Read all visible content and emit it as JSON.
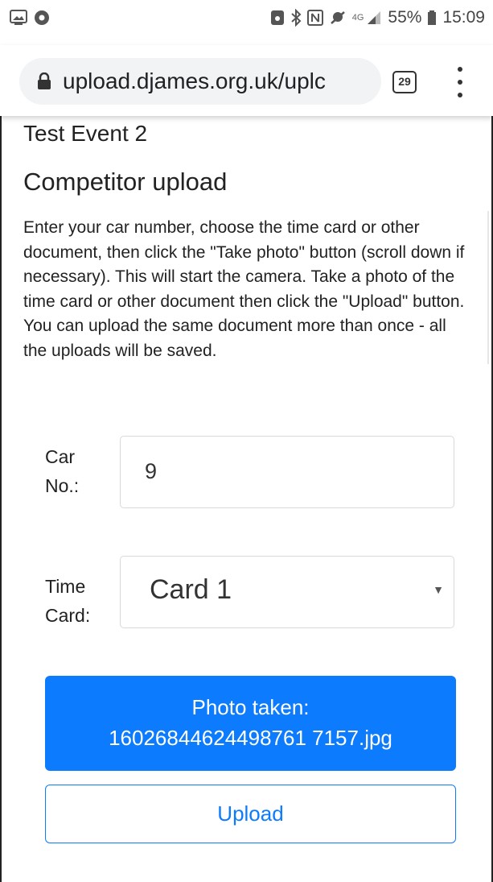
{
  "status_bar": {
    "network": "4G",
    "battery": "55%",
    "time": "15:09"
  },
  "browser": {
    "url": "upload.djames.org.uk/uplc",
    "tab_count": "29"
  },
  "page": {
    "event_name": "Test Event 2",
    "heading": "Competitor upload",
    "instructions": "Enter your car number, choose the time card or other document, then click the \"Take photo\" button (scroll down if necessary). This will start the camera. Take a photo of the time card or other document then click the \"Upload\" button. You can upload the same document more than once - all the uploads will be saved."
  },
  "form": {
    "car_no_label_line1": "Car",
    "car_no_label_line2": "No.:",
    "car_no_value": "9",
    "time_card_label_line1": "Time",
    "time_card_label_line2": "Card:",
    "time_card_selected": "Card 1",
    "photo_button_line1": "Photo taken:",
    "photo_button_line2": "16026844624498761 7157.jpg",
    "upload_button": "Upload"
  },
  "colors": {
    "primary": "#0d7bfd",
    "omnibox": "#f1f3f4"
  }
}
